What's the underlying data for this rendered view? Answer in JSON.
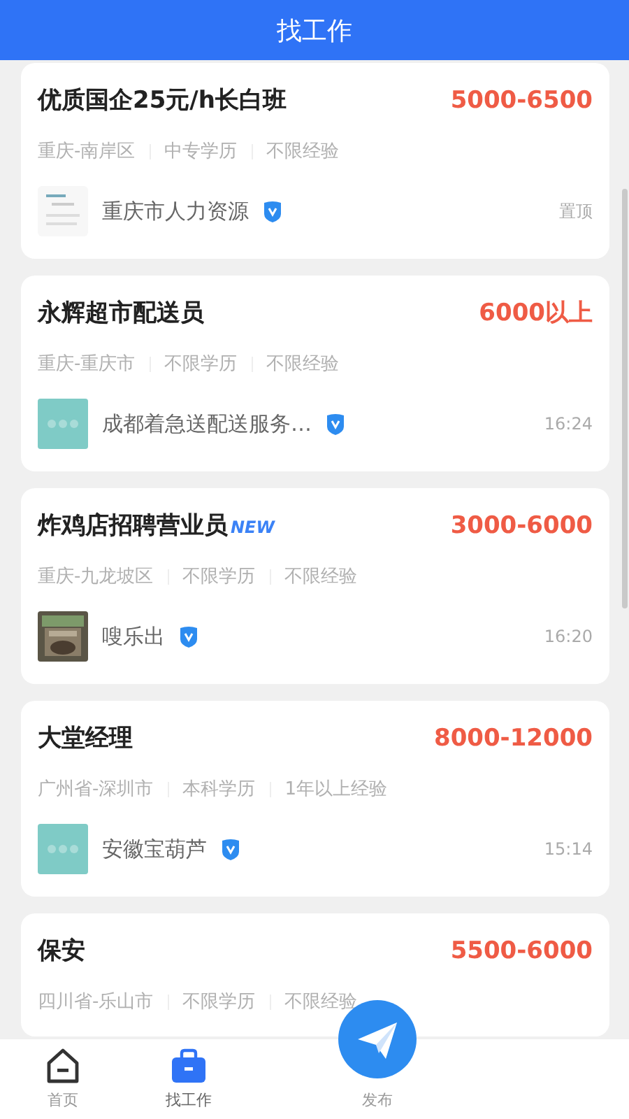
{
  "header": {
    "title": "找工作"
  },
  "jobs": [
    {
      "title": "优质国企25元/h长白班",
      "is_new": false,
      "salary": "5000-6500",
      "tags": [
        "重庆-南岸区",
        "中专学历",
        "不限经验"
      ],
      "company": "重庆市人力资源",
      "verified": true,
      "time": "置顶"
    },
    {
      "title": "永辉超市配送员",
      "is_new": false,
      "salary": "6000以上",
      "tags": [
        "重庆-重庆市",
        "不限学历",
        "不限经验"
      ],
      "company": "成都着急送配送服务…",
      "verified": true,
      "time": "16:24"
    },
    {
      "title": "炸鸡店招聘营业员",
      "is_new": true,
      "new_label": "NEW",
      "salary": "3000-6000",
      "tags": [
        "重庆-九龙坡区",
        "不限学历",
        "不限经验"
      ],
      "company": "嗖乐出",
      "verified": true,
      "time": "16:20"
    },
    {
      "title": "大堂经理",
      "is_new": false,
      "salary": "8000-12000",
      "tags": [
        "广州省-深圳市",
        "本科学历",
        "1年以上经验"
      ],
      "company": "安徽宝葫芦",
      "verified": true,
      "time": "15:14"
    },
    {
      "title": "保安",
      "is_new": false,
      "salary": "5500-6000",
      "tags": [
        "四川省-乐山市",
        "不限学历",
        "不限经验"
      ]
    }
  ],
  "nav": [
    {
      "label": "首页",
      "selected": false
    },
    {
      "label": "找工作",
      "selected": true
    },
    {
      "label": "发布",
      "selected": false
    }
  ]
}
